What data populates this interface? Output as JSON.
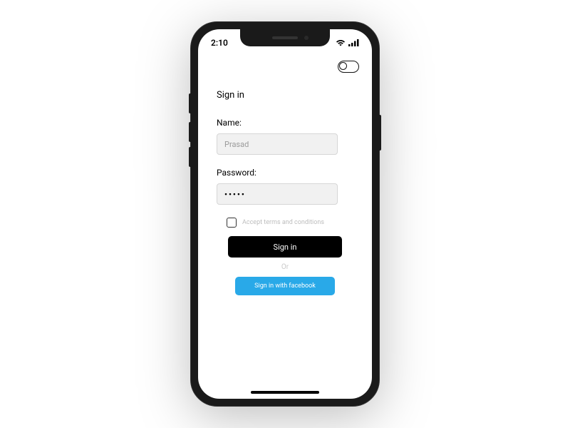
{
  "statusBar": {
    "time": "2:10"
  },
  "toggle": {
    "on": false
  },
  "form": {
    "title": "Sign in",
    "nameLabel": "Name:",
    "namePlaceholder": "Prasad",
    "nameValue": "",
    "passwordLabel": "Password:",
    "passwordValue": "•••••",
    "termsLabel": "Accept terms and conditions",
    "termsChecked": false,
    "signInButton": "Sign in",
    "dividerText": "Or",
    "facebookButton": "Sign in with facebook"
  }
}
